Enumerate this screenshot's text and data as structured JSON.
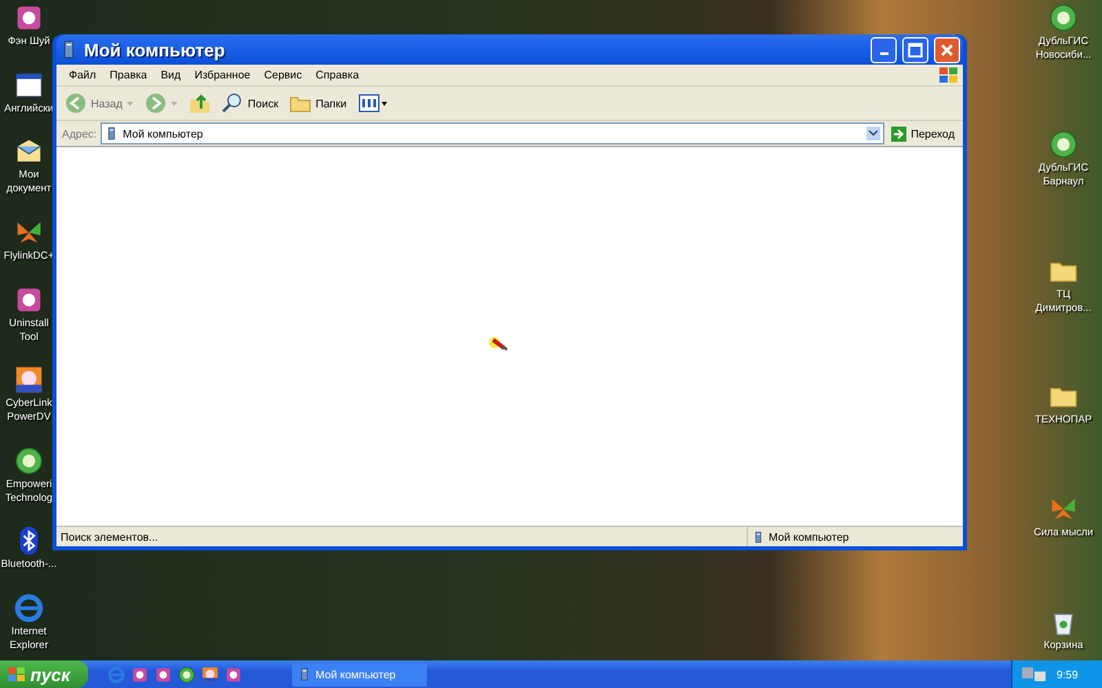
{
  "desktop": {
    "left_icons": [
      {
        "kind": "app",
        "lines": [
          "Фэн Шуй"
        ]
      },
      {
        "kind": "window",
        "lines": [
          "Английски"
        ]
      },
      {
        "kind": "documents",
        "lines": [
          "Мои",
          "документ"
        ]
      },
      {
        "kind": "butterfly",
        "lines": [
          "FlylinkDC+"
        ]
      },
      {
        "kind": "app",
        "lines": [
          "Uninstall",
          "Tool"
        ]
      },
      {
        "kind": "dvd",
        "lines": [
          "CyberLink",
          "PowerDV"
        ]
      },
      {
        "kind": "globe",
        "lines": [
          "Empoweri",
          "Technolog"
        ]
      },
      {
        "kind": "bluetooth",
        "lines": [
          "Bluetooth-..."
        ]
      },
      {
        "kind": "ie",
        "lines": [
          "Internet",
          "Explorer"
        ]
      }
    ],
    "right_icons": [
      {
        "kind": "globe",
        "lines": [
          "ДубльГИС",
          "Новосиби..."
        ]
      },
      {
        "kind": "globe",
        "lines": [
          "ДубльГИС",
          "Барнаул"
        ]
      },
      {
        "kind": "folder",
        "lines": [
          "ТЦ",
          "Димитров..."
        ]
      },
      {
        "kind": "folder",
        "lines": [
          "ТЕХНОПАР"
        ]
      },
      {
        "kind": "butterfly",
        "lines": [
          "Сила мысли"
        ]
      },
      {
        "kind": "bin",
        "lines": [
          "Корзина"
        ]
      }
    ]
  },
  "window": {
    "title": "Мой компьютер",
    "menu": [
      "Файл",
      "Правка",
      "Вид",
      "Избранное",
      "Сервис",
      "Справка"
    ],
    "toolbar": [
      {
        "kind": "back",
        "label": "Назад",
        "disabled": true
      },
      {
        "kind": "forward",
        "disabled": true
      },
      {
        "kind": "up",
        "disabled": false
      },
      {
        "kind": "search",
        "label": "Поиск",
        "disabled": false
      },
      {
        "kind": "folders",
        "label": "Папки",
        "disabled": false
      },
      {
        "kind": "views",
        "disabled": false
      }
    ],
    "address": {
      "label": "Адрес:",
      "value": "Мой компьютер",
      "go": "Переход"
    },
    "status_bar": {
      "left": "Поиск элементов...",
      "right": "Мой компьютер"
    }
  },
  "taskbar": {
    "start": "пуск",
    "tasks": [
      {
        "label": "Мой компьютер"
      }
    ],
    "clock": "9:59"
  }
}
